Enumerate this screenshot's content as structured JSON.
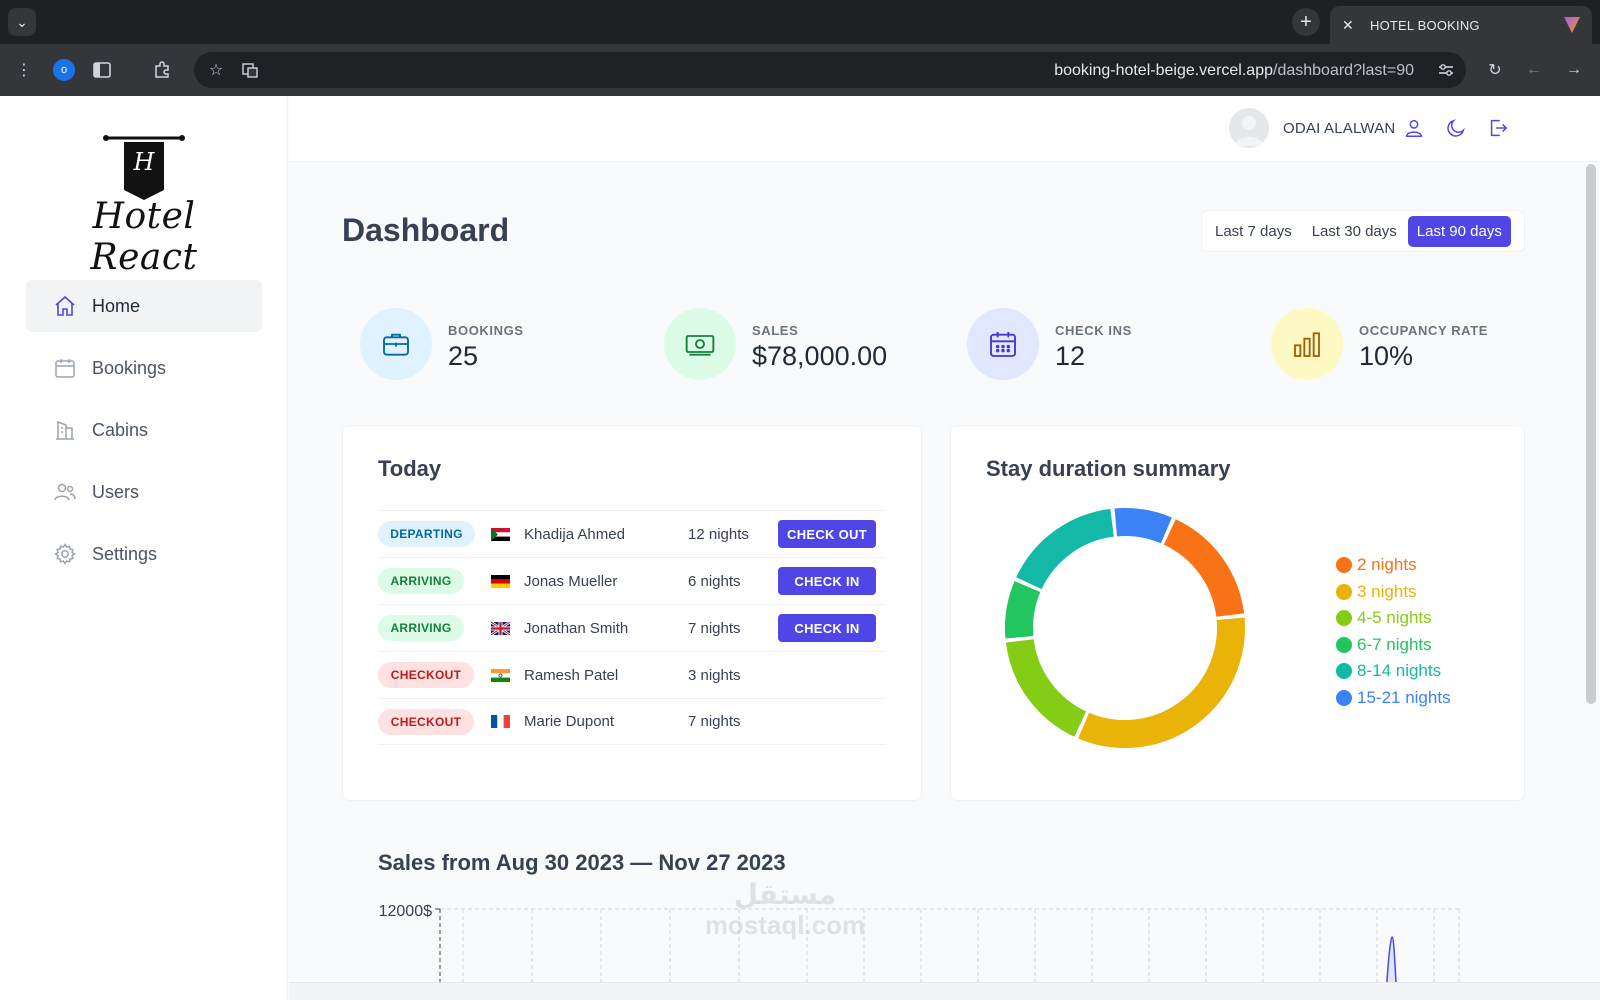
{
  "browser": {
    "tab_title": "HOTEL BOOKING",
    "url_host": "booking-hotel-beige.vercel.app",
    "url_path": "/dashboard?last=90",
    "profile_initial": "o"
  },
  "sidebar": {
    "logo_letter": "H",
    "logo_text": "Hotel React",
    "items": [
      {
        "label": "Home",
        "icon": "home-icon",
        "active": true
      },
      {
        "label": "Bookings",
        "icon": "calendar-icon"
      },
      {
        "label": "Cabins",
        "icon": "building-icon"
      },
      {
        "label": "Users",
        "icon": "users-icon"
      },
      {
        "label": "Settings",
        "icon": "gear-icon"
      }
    ]
  },
  "header": {
    "username": "ODAI ALALWAN"
  },
  "dashboard": {
    "title": "Dashboard",
    "filters": [
      "Last 7 days",
      "Last 30 days",
      "Last 90 days"
    ],
    "active_filter": "Last 90 days",
    "stats": [
      {
        "label": "BOOKINGS",
        "value": "25",
        "icon": "briefcase-icon",
        "color": "#e0f2fe",
        "icon_color": "#0369a1"
      },
      {
        "label": "SALES",
        "value": "$78,000.00",
        "icon": "banknotes-icon",
        "color": "#dcfce7",
        "icon_color": "#15803d"
      },
      {
        "label": "CHECK INS",
        "value": "12",
        "icon": "calendar-days-icon",
        "color": "#e0e7ff",
        "icon_color": "#4338ca"
      },
      {
        "label": "OCCUPANCY RATE",
        "value": "10%",
        "icon": "chart-bar-icon",
        "color": "#fef9c3",
        "icon_color": "#a16207"
      }
    ]
  },
  "today": {
    "title": "Today",
    "rows": [
      {
        "status": "DEPARTING",
        "type": "departing",
        "flag": "sudan",
        "guest": "Khadija Ahmed",
        "nights": "12 nights",
        "action": "CHECK OUT"
      },
      {
        "status": "ARRIVING",
        "type": "arriving",
        "flag": "germany",
        "guest": "Jonas Mueller",
        "nights": "6 nights",
        "action": "CHECK IN"
      },
      {
        "status": "ARRIVING",
        "type": "arriving",
        "flag": "uk",
        "guest": "Jonathan Smith",
        "nights": "7 nights",
        "action": "CHECK IN"
      },
      {
        "status": "CHECKOUT",
        "type": "checkout",
        "flag": "india",
        "guest": "Ramesh Patel",
        "nights": "3 nights",
        "action": ""
      },
      {
        "status": "CHECKOUT",
        "type": "checkout",
        "flag": "france",
        "guest": "Marie Dupont",
        "nights": "7 nights",
        "action": ""
      }
    ]
  },
  "stay_summary": {
    "title": "Stay duration summary"
  },
  "chart_data": {
    "type": "pie",
    "categories": [
      "2 nights",
      "3 nights",
      "4-5 nights",
      "6-7 nights",
      "8-14 nights",
      "15-21 nights"
    ],
    "values": [
      3,
      6,
      3,
      1.5,
      3,
      1.5
    ],
    "colors": [
      "#f97316",
      "#eab308",
      "#84cc16",
      "#22c55e",
      "#14b8a6",
      "#3b82f6"
    ],
    "donut": true,
    "legend": "right"
  },
  "sales": {
    "title": "Sales from Aug 30 2023 — Nov 27 2023",
    "y_top_label": "12000$"
  },
  "watermark": {
    "line1": "مستقل",
    "line2": "mostaql.com"
  }
}
